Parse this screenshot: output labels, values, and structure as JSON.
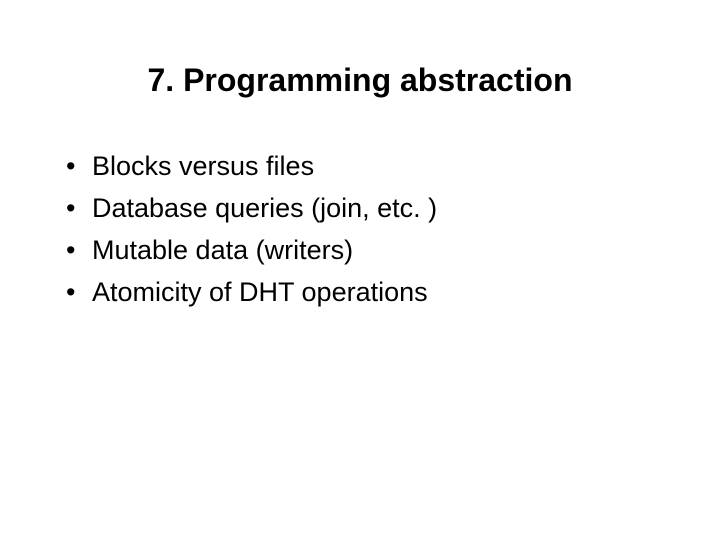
{
  "slide": {
    "title": "7. Programming abstraction",
    "bullets": [
      "Blocks versus files",
      "Database queries (join, etc. )",
      "Mutable data (writers)",
      "Atomicity of DHT operations"
    ],
    "bullet_char": "•"
  }
}
